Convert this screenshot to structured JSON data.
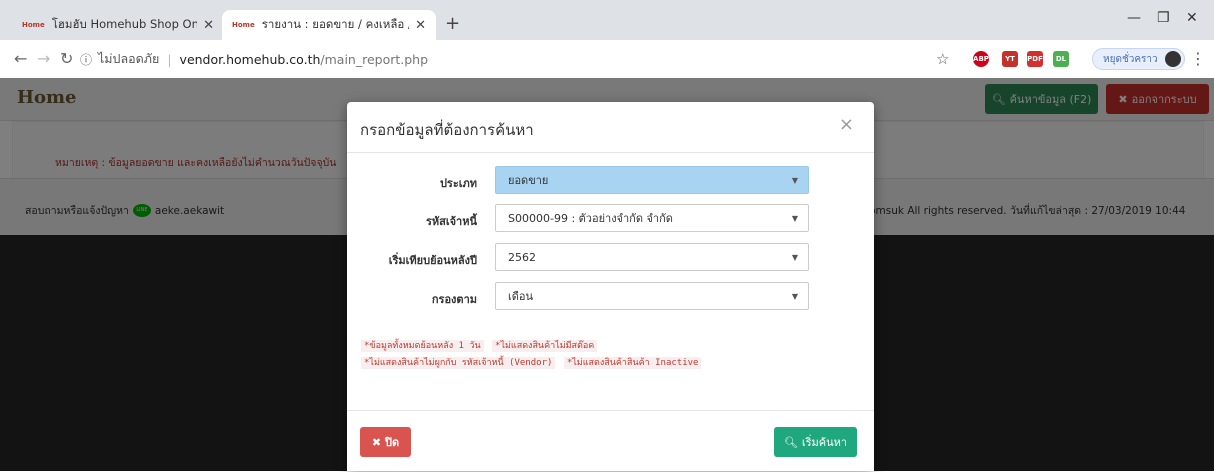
{
  "browser": {
    "tabs": [
      {
        "favicon": "Home",
        "title": "โฮมฮับ Homehub Shop Online"
      },
      {
        "favicon": "Home",
        "title": "รายงาน : ยอดขาย / คงเหลือ / สินค้าใน"
      }
    ],
    "new_tab": "+",
    "security_label": "ไม่ปลอดภัย",
    "url_host": "vendor.homehub.co.th",
    "url_path": "/main_report.php",
    "profile_label": "หยุดชั่วคราว",
    "extensions": [
      "ABP",
      "YT",
      "PDF",
      "DL"
    ]
  },
  "header": {
    "logo": "Home",
    "search_label": "ค้นหาข้อมูล (F2)",
    "logout_label": "ออกจากระบบ"
  },
  "note": "หมายเหตุ : ข้อมูลยอดขาย และคงเหลือยังไม่คำนวณวันปัจจุบัน",
  "footer": {
    "contact_label": "สอบถามหรือแจ้งปัญหา",
    "line_icon": "LINE",
    "line_id": "aeke.aekawit",
    "copyright": "iyomsuk All rights reserved. วันที่แก้ไขล่าสุด : 27/03/2019 10:44"
  },
  "modal": {
    "title": "กรอกข้อมูลที่ต้องการค้นหา",
    "close_symbol": "×",
    "fields": [
      {
        "label": "ประเภท",
        "value": "ยอดขาย"
      },
      {
        "label": "รหัสเจ้าหนี้",
        "value": "S00000-99 : ตัวอย่างจำกัด จำกัด"
      },
      {
        "label": "เริ่มเทียบย้อนหลังปี",
        "value": "2562"
      },
      {
        "label": "กรองตาม",
        "value": "เดือน"
      }
    ],
    "hints": [
      "*ข้อมูลทั้งหมดย้อนหลัง 1 วัน",
      "*ไม่แสดงสินค้าไม่มีสต๊อค",
      "*ไม่แสดงสินค้าไม่ผูกกับ รหัสเจ้าหนี้ (Vendor)",
      "*ไม่แสดงสินค้าสินค้า Inactive"
    ],
    "close_button": "ปิด",
    "search_button": "เริ่มค้นหา"
  },
  "colors": {
    "accent_green": "#2e8b57",
    "danger_red": "#c9302c",
    "highlight_blue": "#a8d4f2",
    "search_green": "#1fa77d"
  },
  "icons": [
    "search-icon",
    "x-icon",
    "close-icon",
    "star-icon",
    "info-icon",
    "back-arrow-icon",
    "forward-arrow-icon",
    "reload-icon",
    "kebab-menu-icon"
  ]
}
